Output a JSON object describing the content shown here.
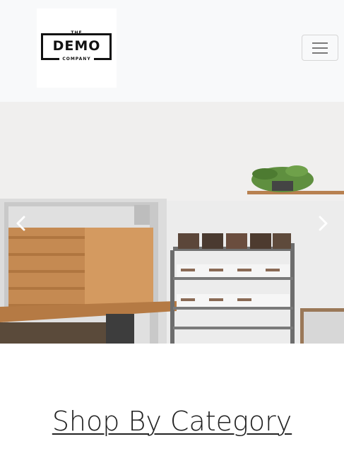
{
  "navbar": {
    "logo": {
      "top": "THE",
      "main": "DEMO",
      "bottom": "COMPANY"
    },
    "toggler_icon": "hamburger-icon"
  },
  "carousel": {
    "prev_icon": "chevron-left-icon",
    "next_icon": "chevron-right-icon",
    "slide_image": "coffee-shop-interior-photo"
  },
  "section": {
    "heading": "Shop By Category"
  },
  "colors": {
    "navbar_bg": "#f8f9fa",
    "wall": "#ededed",
    "wood": "#c98a4e",
    "shelf_metal": "#777777"
  }
}
